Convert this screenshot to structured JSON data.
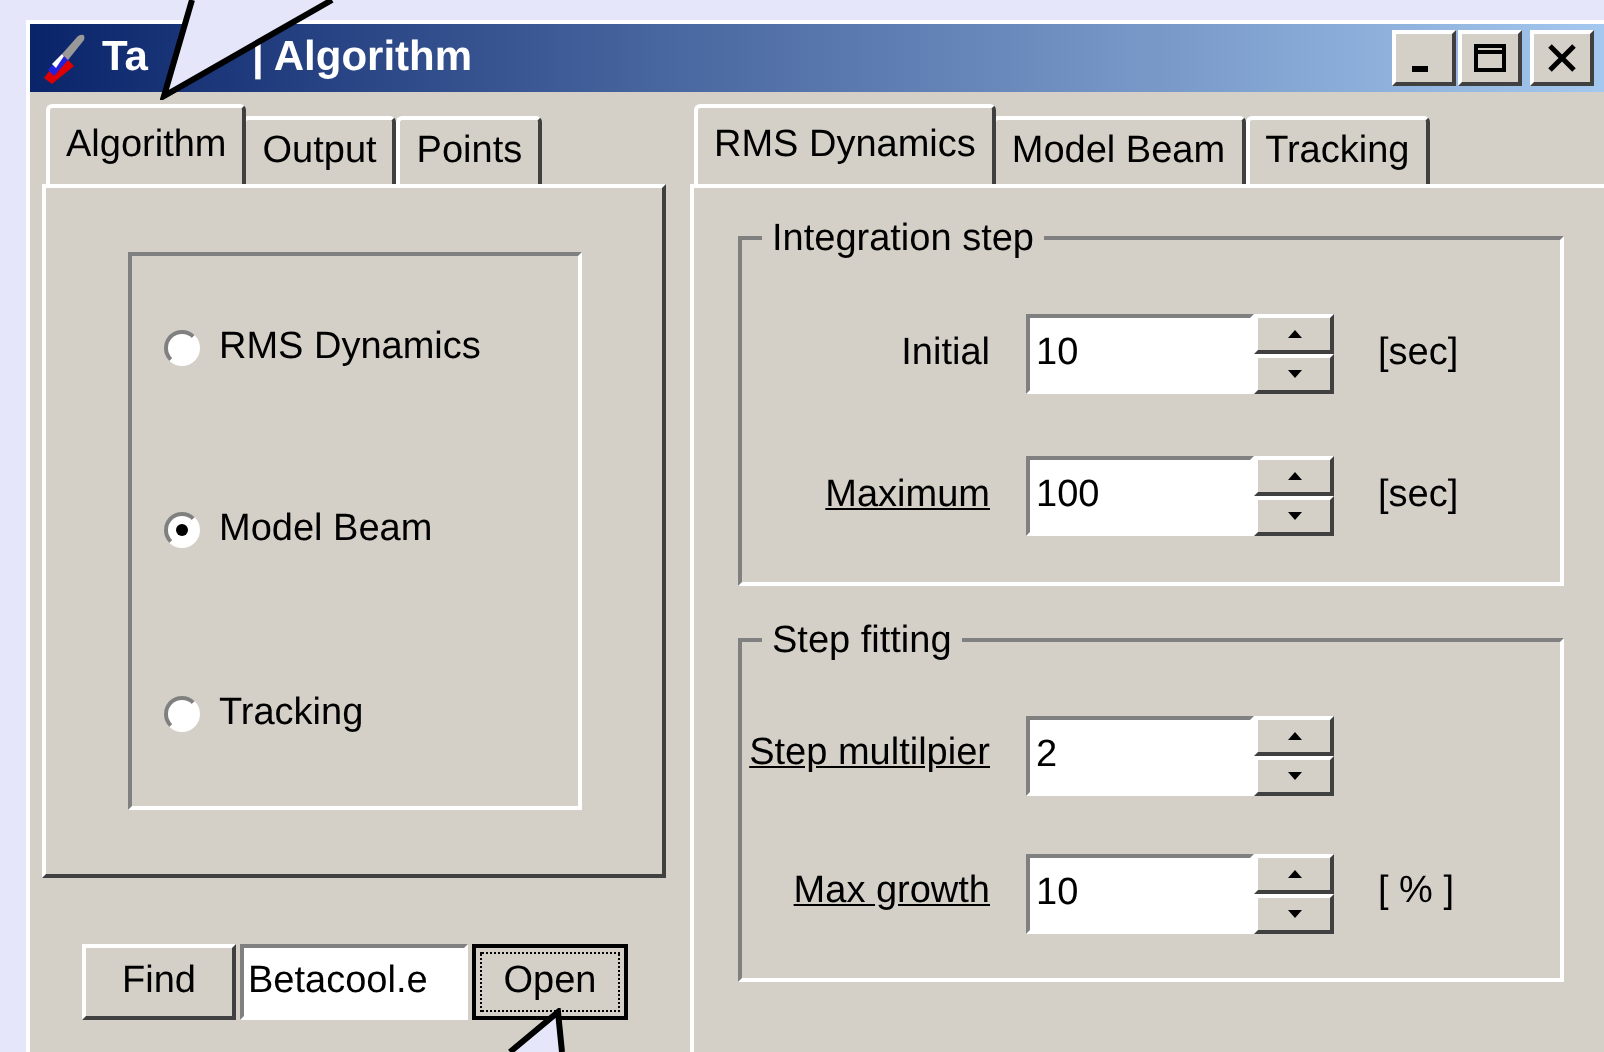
{
  "window": {
    "title_parts": [
      "Ta",
      "| Algorithm"
    ]
  },
  "left_tabs": [
    {
      "label": "Algorithm",
      "selected": true
    },
    {
      "label": "Output",
      "selected": false
    },
    {
      "label": "Points",
      "selected": false
    }
  ],
  "algorithms": [
    {
      "label": "RMS Dynamics",
      "selected": false
    },
    {
      "label": "Model Beam",
      "selected": true
    },
    {
      "label": "Tracking",
      "selected": false
    }
  ],
  "find_bar": {
    "find_button": "Find",
    "file_value": "Betacool.e",
    "open_button": "Open"
  },
  "right_tabs": [
    {
      "label": "RMS Dynamics",
      "selected": true
    },
    {
      "label": "Model Beam",
      "selected": false
    },
    {
      "label": "Tracking",
      "selected": false
    }
  ],
  "groups": [
    {
      "title": "Integration step",
      "fields": [
        {
          "label": "Initial",
          "underlined": false,
          "value": "10",
          "unit": "[sec]"
        },
        {
          "label": "Maximum",
          "underlined": true,
          "value": "100",
          "unit": "[sec]"
        }
      ]
    },
    {
      "title": "Step fitting",
      "fields": [
        {
          "label": "Step multilpier",
          "underlined": true,
          "value": "2"
        },
        {
          "label": "Max growth",
          "underlined": true,
          "value": "10",
          "unit": "[ % ]"
        }
      ]
    }
  ]
}
